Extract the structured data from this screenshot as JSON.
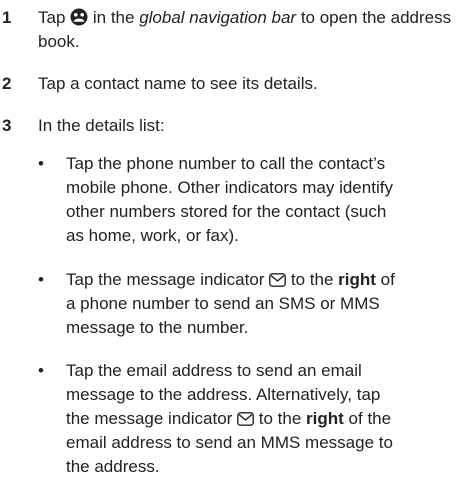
{
  "steps": [
    {
      "number": "1",
      "text_before_icon": "Tap ",
      "icon": "contacts-icon",
      "text_after_icon": " in the ",
      "emphasis": "global navigation bar",
      "text_end": " to open the address book."
    },
    {
      "number": "2",
      "text": "Tap a contact name to see its details."
    },
    {
      "number": "3",
      "text": "In the details list:",
      "bullets": [
        {
          "dot": "•",
          "text": "Tap the phone number to call the contact’s mobile phone. Other indicators may identify other numbers stored for the contact (such as home, work, or fax)."
        },
        {
          "dot": "•",
          "text_before_icon": "Tap the message indicator ",
          "icon": "message-envelope-icon",
          "text_after_icon": " to the ",
          "bold": "right",
          "text_end": " of a phone number to send an SMS or MMS message to the number."
        },
        {
          "dot": "•",
          "text_before_icon": "Tap the email address to send an email message to the address. Alternatively, tap the message indicator ",
          "icon": "message-envelope-icon",
          "text_after_icon": " to the ",
          "bold": "right",
          "text_end": " of the email address to send an MMS message to the address."
        }
      ]
    }
  ]
}
